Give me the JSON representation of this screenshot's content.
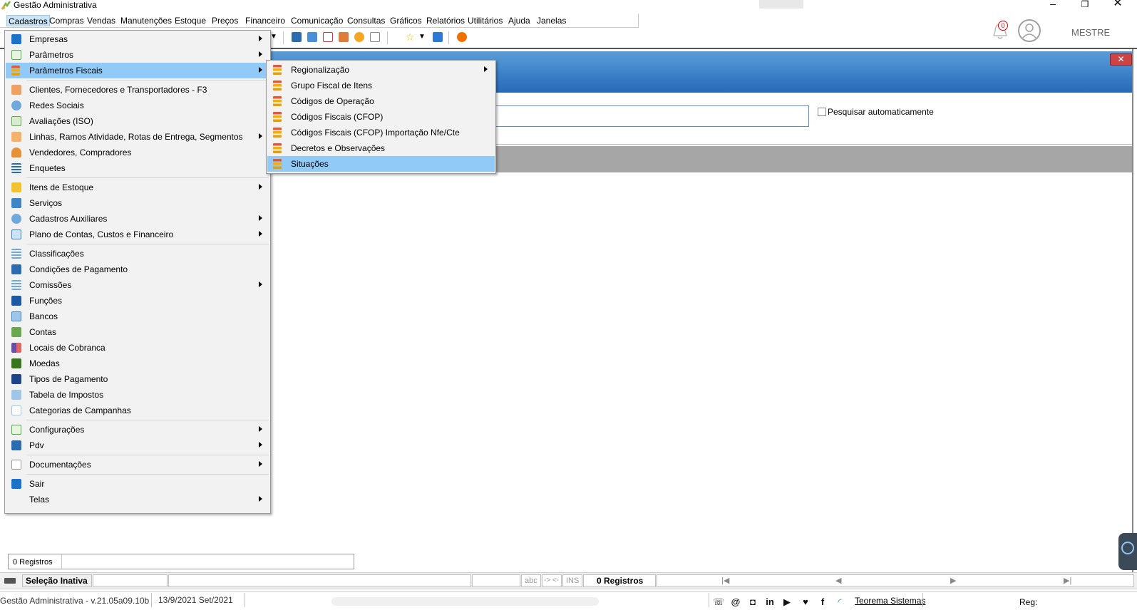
{
  "app": {
    "title": "Gestão Administrativa",
    "user": "MESTRE",
    "notifications": "0"
  },
  "menubar": [
    "Cadastros",
    "Compras",
    "Vendas",
    "Manutenções",
    "Estoque",
    "Preços",
    "Financeiro",
    "Comunicação",
    "Consultas",
    "Gráficos",
    "Relatórios",
    "Utilitários",
    "Ajuda",
    "Janelas"
  ],
  "cadastros_menu": [
    {
      "label": "Empresas",
      "icon": "building-icon",
      "submenu": true
    },
    {
      "label": "Parâmetros",
      "icon": "grid-icon",
      "submenu": true
    },
    {
      "label": "Parâmetros Fiscais",
      "icon": "fiscal-icon",
      "submenu": true
    },
    {
      "label": "Clientes, Fornecedores e Transportadores - F3",
      "icon": "people-icon",
      "submenu": false
    },
    {
      "label": "Redes Sociais",
      "icon": "network-icon",
      "submenu": false
    },
    {
      "label": "Avaliações (ISO)",
      "icon": "evaluation-icon",
      "submenu": false
    },
    {
      "label": "Linhas, Ramos Atividade, Rotas de Entrega, Segmentos",
      "icon": "tree-icon",
      "submenu": true
    },
    {
      "label": "Vendedores, Compradores",
      "icon": "person-icon",
      "submenu": false
    },
    {
      "label": "Enquetes",
      "icon": "list-icon",
      "submenu": false
    },
    {
      "label": "Itens de Estoque",
      "icon": "box-icon",
      "submenu": true
    },
    {
      "label": "Serviços",
      "icon": "service-icon",
      "submenu": false
    },
    {
      "label": "Cadastros Auxiliares",
      "icon": "network-icon",
      "submenu": true
    },
    {
      "label": "Plano de Contas, Custos e Financeiro",
      "icon": "ledger-icon",
      "submenu": true
    },
    {
      "label": "Classificações",
      "icon": "lines-icon",
      "submenu": false
    },
    {
      "label": "Condições de Pagamento",
      "icon": "dollar-doc-icon",
      "submenu": false
    },
    {
      "label": "Comissões",
      "icon": "lines-icon",
      "submenu": true
    },
    {
      "label": "Funções",
      "icon": "book-icon",
      "submenu": false
    },
    {
      "label": "Bancos",
      "icon": "bank-icon",
      "submenu": false
    },
    {
      "label": "Contas",
      "icon": "money-icon",
      "submenu": false
    },
    {
      "label": "Locais de Cobranca",
      "icon": "blocks-icon",
      "submenu": false
    },
    {
      "label": "Moedas",
      "icon": "coins-icon",
      "submenu": false
    },
    {
      "label": "Tipos de Pagamento",
      "icon": "visa-icon",
      "submenu": false
    },
    {
      "label": "Tabela de Impostos",
      "icon": "table-icon",
      "submenu": false
    },
    {
      "label": "Categorias de Campanhas",
      "icon": "grid-icon",
      "submenu": false
    },
    {
      "label": "Configurações",
      "icon": "grid-icon",
      "submenu": true
    },
    {
      "label": "Pdv",
      "icon": "monitor-icon",
      "submenu": true
    },
    {
      "label": "Documentações",
      "icon": "doc-icon",
      "submenu": true
    },
    {
      "label": "Sair",
      "icon": "exit-icon",
      "submenu": false
    },
    {
      "label": "Telas",
      "icon": "",
      "submenu": true
    }
  ],
  "fiscal_submenu": [
    {
      "label": "Regionalização",
      "submenu": true
    },
    {
      "label": "Grupo Fiscal de Itens",
      "submenu": false
    },
    {
      "label": "Códigos de Operação",
      "submenu": false
    },
    {
      "label": "Códigos Fiscais (CFOP)",
      "submenu": false
    },
    {
      "label": "Códigos Fiscais (CFOP)  Importação Nfe/Cte",
      "submenu": false
    },
    {
      "label": "Decretos e Observações",
      "submenu": false
    },
    {
      "label": "Situações",
      "submenu": false
    }
  ],
  "search": {
    "value": "",
    "auto_label": "Pesquisar automaticamente"
  },
  "records_panel": "0 Registros",
  "statusbar": {
    "selection": "Seleção Inativa",
    "abc": "abc",
    "arrows": "-> <-",
    "ins": "INS",
    "records": "0 Registros",
    "nav_first": "|◀",
    "nav_prev": "◀",
    "nav_next": "▶",
    "nav_last": "▶|"
  },
  "footer": {
    "version": "Gestão Administrativa - v.21.05a09.10b",
    "date": "13/9/2021 Set/2021",
    "company": "Teorema Sistemas",
    "reg": "Reg:"
  }
}
